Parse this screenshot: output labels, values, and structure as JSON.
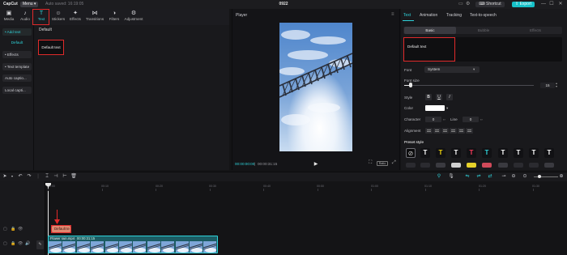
{
  "titlebar": {
    "app_name": "CapCut",
    "menu_label": "Menu",
    "autosave": "Auto saved: 16:19:05",
    "project_title": "0922",
    "shortcut_label": "Shortcut",
    "export_label": "Export",
    "controls": [
      "—",
      "☐",
      "✕"
    ]
  },
  "toolbar": {
    "tabs": [
      {
        "label": "Media",
        "icon": "media-icon",
        "glyph": "▣"
      },
      {
        "label": "Audio",
        "icon": "audio-icon",
        "glyph": "♪"
      },
      {
        "label": "Text",
        "icon": "text-icon",
        "glyph": "T"
      },
      {
        "label": "Stickers",
        "icon": "sticker-icon",
        "glyph": "☺"
      },
      {
        "label": "Effects",
        "icon": "effects-icon",
        "glyph": "✦"
      },
      {
        "label": "Transitions",
        "icon": "transitions-icon",
        "glyph": "⋈"
      },
      {
        "label": "Filters",
        "icon": "filters-icon",
        "glyph": "◑"
      },
      {
        "label": "Adjustment",
        "icon": "adjustment-icon",
        "glyph": "⚙"
      }
    ],
    "active_tab": "Text"
  },
  "sidebar": {
    "items": [
      {
        "label": "• Add text"
      },
      {
        "label": "Default"
      },
      {
        "label": "• Effects"
      },
      {
        "label": "• Text template"
      },
      {
        "label": "Auto captio..."
      },
      {
        "label": "Local capti..."
      }
    ]
  },
  "content": {
    "heading": "Default",
    "card_label": "Default text"
  },
  "player": {
    "title": "Player",
    "menu_glyph": "≡",
    "current_time": "00:00:00:00",
    "total_time": "00:00:31:15",
    "ratio_label": "Ratio"
  },
  "right_panel": {
    "tabs": [
      "Text",
      "Animation",
      "Tracking",
      "Text-to-speech"
    ],
    "subtabs": [
      "Basic",
      "Bubble",
      "Effects"
    ],
    "text_value": "Default text",
    "font_label": "Font",
    "font_value": "System",
    "font_size_label": "Font size",
    "font_size_value": "15",
    "font_size_fraction": 0.05,
    "style_label": "Style",
    "style_buttons": [
      "B",
      "U",
      "I"
    ],
    "color_label": "Color",
    "color_value": "#ffffff",
    "character_label": "Character",
    "character_value": "0",
    "line_label": "Line",
    "line_value": "0",
    "alignment_label": "Alignment",
    "preset_label": "Preset style",
    "presets": [
      {
        "glyph": "T",
        "color": "#ffffff"
      },
      {
        "glyph": "T",
        "color": "#ffffff"
      },
      {
        "glyph": "T",
        "color": "#f5d90a"
      },
      {
        "glyph": "T",
        "color": "#ffffff"
      },
      {
        "glyph": "T",
        "color": "#ff3b5c"
      },
      {
        "glyph": "T",
        "color": "#2fd3da"
      },
      {
        "glyph": "T",
        "color": "#ffffff"
      },
      {
        "glyph": "T",
        "color": "#ffffff"
      }
    ],
    "preset2_colors": [
      "#2b2b30",
      "#2b2b30",
      "#3a3a40",
      "#d0d0d0",
      "#e6d12a",
      "#d04a5a",
      "#3a3a40",
      "#2b2b30",
      "#2b2b30",
      "#3a3a40"
    ]
  },
  "timeline": {
    "ruler": [
      "00:00",
      "00:10",
      "00:20",
      "00:30",
      "00:40",
      "00:50",
      "01:00",
      "01:10",
      "01:20",
      "01:30",
      "01:40"
    ],
    "text_clip_label": "Default te",
    "video_clip_name": "Flower rain.mp4",
    "video_clip_duration": "00:00:31:15"
  }
}
